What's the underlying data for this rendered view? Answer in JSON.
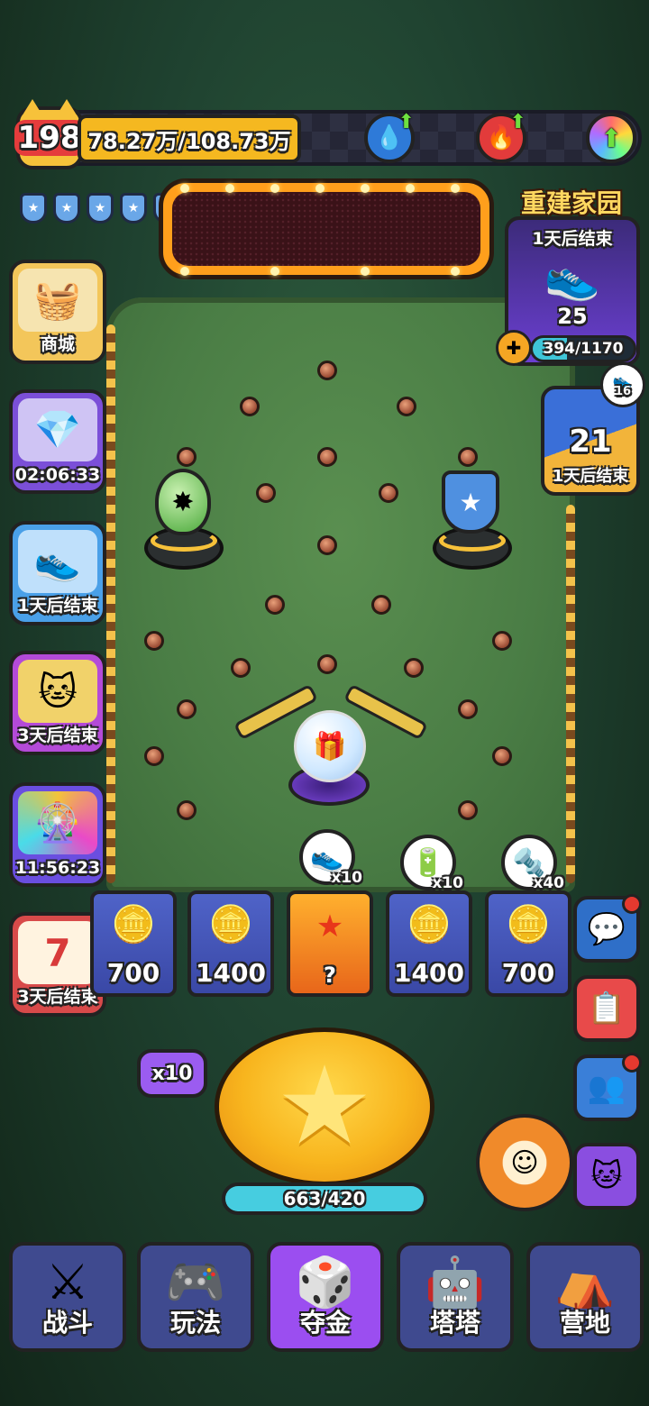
{
  "header": {
    "level": "198",
    "coins": "78.27万/108.73万",
    "icons": [
      "water-drop-upgrade-icon",
      "fire-upgrade-icon",
      "rainbow-upgrade-icon"
    ]
  },
  "shields": {
    "count": 5
  },
  "event": {
    "title": "重建家园",
    "status": "1天后结束",
    "item_count": "25",
    "progress_text": "394/1170",
    "progress": 0.337
  },
  "event2": {
    "badge": "16",
    "number": "21",
    "status": "1天后结束"
  },
  "left_menu": [
    {
      "label": "商城",
      "icon": "shop-basket-icon"
    },
    {
      "label": "02:06:33",
      "icon": "gem-chest-icon"
    },
    {
      "label": "1天后结束",
      "icon": "sneaker-icon"
    },
    {
      "label": "3天后结束",
      "icon": "gold-cat-icon"
    },
    {
      "label": "11:56:23",
      "icon": "wheel-icon"
    },
    {
      "label": "3天后结束",
      "icon": "calendar-icon"
    }
  ],
  "calendar_day": "7",
  "rewards": [
    {
      "icon": "sneaker-icon",
      "mult": "x10"
    },
    {
      "icon": "battery-icon",
      "mult": "x10"
    },
    {
      "icon": "screw-icon",
      "mult": "x40"
    }
  ],
  "slots": [
    "700",
    "1400",
    "?",
    "1400",
    "700"
  ],
  "multiplier": "x10",
  "energy": {
    "text": "663/420",
    "fill": 1.0
  },
  "right_buttons": [
    "chat-icon",
    "clipboard-check-icon",
    "friends-icon",
    "cat-badge-icon"
  ],
  "nav": [
    {
      "label": "战斗",
      "icon": "crossed-swords-icon",
      "active": false
    },
    {
      "label": "玩法",
      "icon": "gamepad-icon",
      "active": false
    },
    {
      "label": "夺金",
      "icon": "dice-faces-icon",
      "active": true
    },
    {
      "label": "塔塔",
      "icon": "robot-cat-icon",
      "active": false
    },
    {
      "label": "营地",
      "icon": "tent-icon",
      "active": false
    }
  ],
  "colors": {
    "accent": "#f7c23a",
    "active_nav": "#9b4ef0",
    "nav": "#3f4a8f",
    "progress": "#3fc6d8"
  }
}
